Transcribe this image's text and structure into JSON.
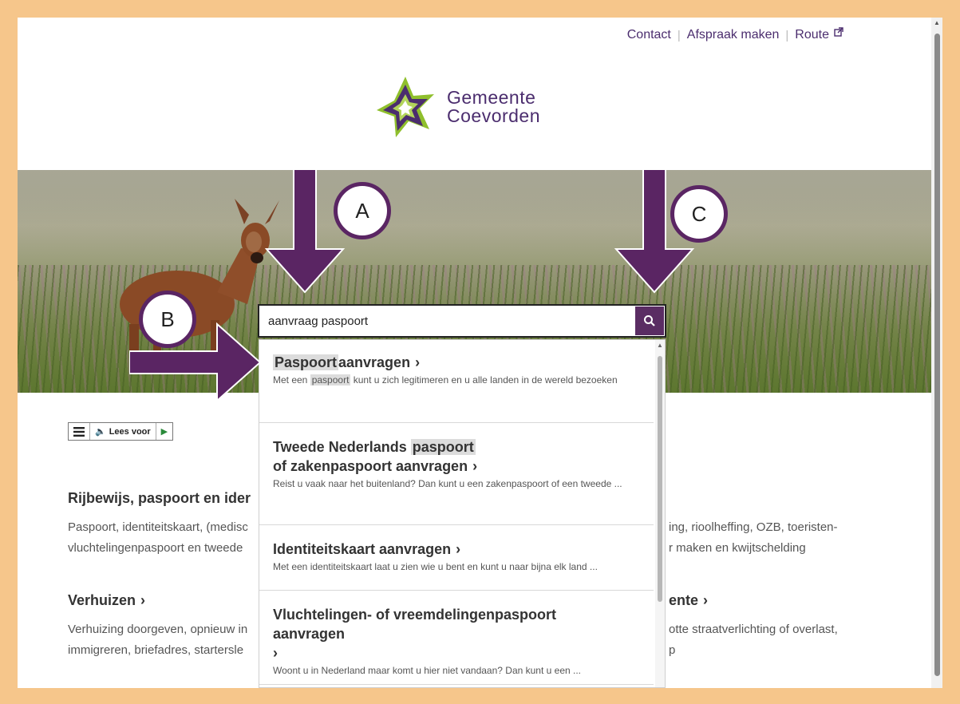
{
  "header": {
    "links": [
      "Contact",
      "Afspraak maken",
      "Route"
    ]
  },
  "logo": {
    "line1": "Gemeente",
    "line2": "Coevorden"
  },
  "search": {
    "value": "aanvraag paspoort",
    "button_icon": "search-icon"
  },
  "dropdown": {
    "items": [
      {
        "title_highlight": "Paspoort",
        "title_rest": "aanvragen",
        "desc_before": "Met een",
        "desc_highlight": "paspoort",
        "desc_after": "kunt u zich legitimeren en u alle landen in de wereld bezoeken"
      },
      {
        "title_before": "Tweede Nederlands",
        "title_highlight": "paspoort",
        "title_line2": "of zakenpaspoort aanvragen",
        "desc": "Reist u vaak naar het buitenland? Dan kunt u een zakenpaspoort of een tweede ..."
      },
      {
        "title": "Identiteitskaart aanvragen",
        "desc": "Met een identiteitskaart laat u zien wie u bent en kunt u naar bijna elk land ..."
      },
      {
        "title_line1": "Vluchtelingen- of vreemdelingenpaspoort",
        "title_line2": "aanvragen",
        "desc": "Woont u in Nederland maar komt u hier niet vandaan? Dan kunt u een ..."
      }
    ]
  },
  "readspeaker": {
    "label": "Lees voor"
  },
  "sections": {
    "left1_title": "Rijbewijs, paspoort en ider",
    "left1_text_1": "Paspoort, identiteitskaart, (medisc",
    "left1_text_2": "vluchtelingenpaspoort en tweede",
    "left2_title": "Verhuizen",
    "left2_text_1": "Verhuizing doorgeven, opnieuw in",
    "left2_text_2": "immigreren, briefadres, startersle",
    "right1_text_1": "ing, rioolheffing, OZB, toeristen-",
    "right1_text_2": "r maken en kwijtschelding",
    "right2_title": "ente",
    "right2_text_1": "otte straatverlichting of overlast,",
    "right2_text_2": "p"
  },
  "annotations": {
    "a": "A",
    "b": "B",
    "c": "C"
  },
  "colors": {
    "brand": "#4b2d6e",
    "annotation": "#5a2563",
    "frame": "#f6c68b"
  }
}
